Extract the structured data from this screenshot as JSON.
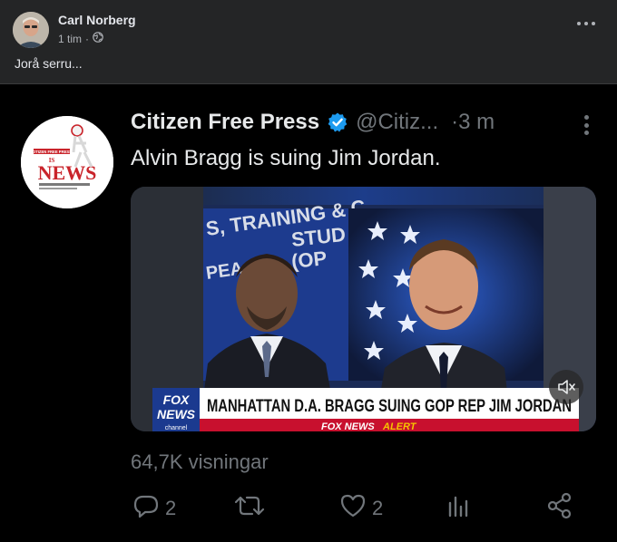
{
  "post": {
    "author": "Carl Norberg",
    "time": "1 tim",
    "separator": "·",
    "text": "Jorå serru..."
  },
  "tweet": {
    "name": "Citizen Free Press",
    "handle": "@Citiz...",
    "time": "·3 m",
    "text": "Alvin Bragg is suing Jim Jordan.",
    "views": "64,7K visningar",
    "replies": "2",
    "likes": "2"
  },
  "media": {
    "chyron_headline": "MANHATTAN D.A. BRAGG SUING GOP REP JIM JORDAN",
    "chyron_sub_brand": "FOX NEWS",
    "chyron_sub_alert": "ALERT",
    "logo_top": "FOX",
    "logo_bottom": "NEWS",
    "logo_channel": "channel",
    "background_sign_lines": [
      "S, TRAINING & C",
      "STUD",
      "(OP",
      "PEA"
    ]
  },
  "avatar_logo": {
    "top": "CITIZEN FREE PRESS",
    "is": "IS",
    "news": "NEWS"
  },
  "icons": {
    "privacy": "globe-icon",
    "post_menu": "more-horizontal-icon",
    "verified": "verified-badge-icon",
    "tweet_menu": "more-vertical-icon",
    "reply": "reply-icon",
    "retweet": "retweet-icon",
    "like": "heart-icon",
    "views": "analytics-icon",
    "share": "share-icon",
    "mute": "volume-muted-icon"
  },
  "colors": {
    "facebook_bg": "#242526",
    "tweet_bg": "#000000",
    "verified_blue": "#1d9bf0",
    "fox_red": "#c8102e",
    "fox_blue": "#1b3a8f"
  }
}
